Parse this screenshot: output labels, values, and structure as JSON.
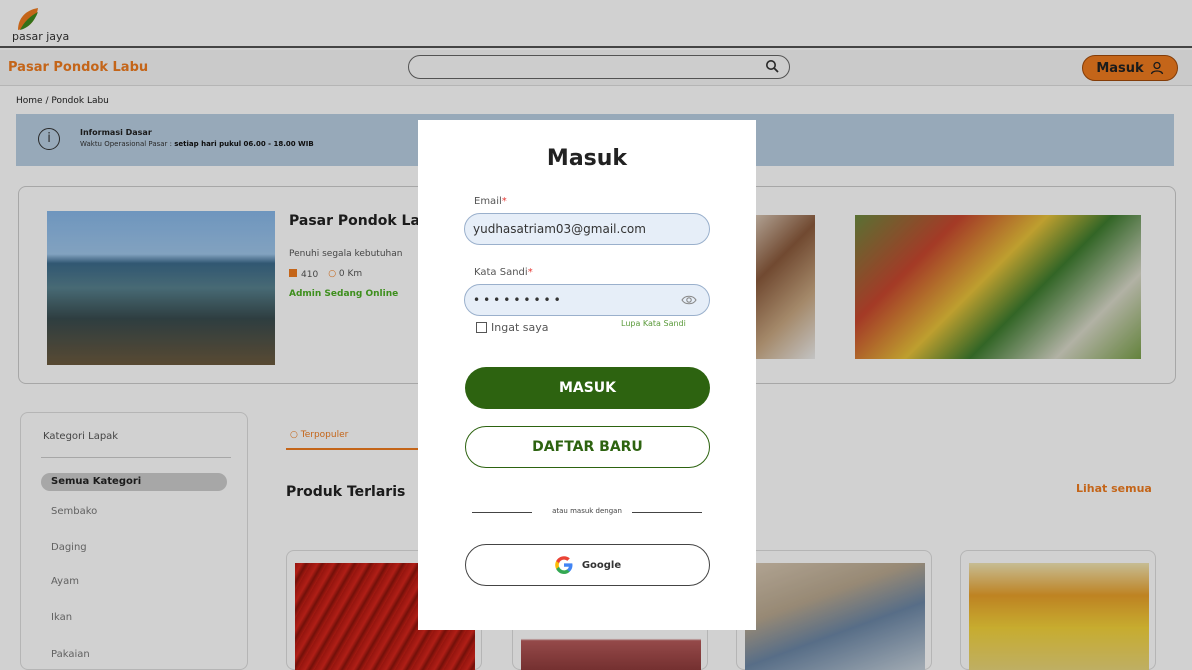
{
  "header": {
    "logo_text": "pasar jaya"
  },
  "navbar": {
    "market_name": "Pasar Pondok Labu",
    "search_placeholder": "",
    "login_label": "Masuk",
    "icons": [
      "search-icon",
      "user-icon"
    ]
  },
  "breadcrumb": "Home / Pondok Labu",
  "info": {
    "title": "Informasi Dasar",
    "text_prefix": "Waktu Operasional Pasar : ",
    "text_bold": "setiap hari pukul 06.00 - 18.00 WIB"
  },
  "market": {
    "title": "Pasar Pondok Lab",
    "description": "Penuhi segala kebutuhan",
    "stalls": "410",
    "distance": "0 Km",
    "admin_status": "Admin Sedang Online"
  },
  "sidebar": {
    "title": "Kategori Lapak",
    "items": [
      {
        "label": "Semua Kategori",
        "active": true
      },
      {
        "label": "Sembako",
        "active": false
      },
      {
        "label": "Daging",
        "active": false
      },
      {
        "label": "Ayam",
        "active": false
      },
      {
        "label": "Ikan",
        "active": false
      },
      {
        "label": "Pakaian",
        "active": false
      }
    ]
  },
  "products": {
    "tab_label": "Terpopuler",
    "section_title": "Produk Terlaris",
    "see_all": "Lihat semua"
  },
  "modal": {
    "title": "Masuk",
    "email_label": "Email",
    "email_value": "yudhasatriam03@gmail.com",
    "password_label": "Kata Sandi",
    "password_value": "•••••••••",
    "remember_label": "Ingat saya",
    "forgot_label": "Lupa Kata Sandi",
    "login_button": "MASUK",
    "register_button": "DAFTAR BARU",
    "or_text": "atau masuk dengan",
    "google_button": "Google",
    "required_mark": "*"
  },
  "colors": {
    "brand_orange": "#f07c1f",
    "brand_green": "#2d6310",
    "online_green": "#4caf24",
    "banner_blue": "#b9cfe2"
  }
}
